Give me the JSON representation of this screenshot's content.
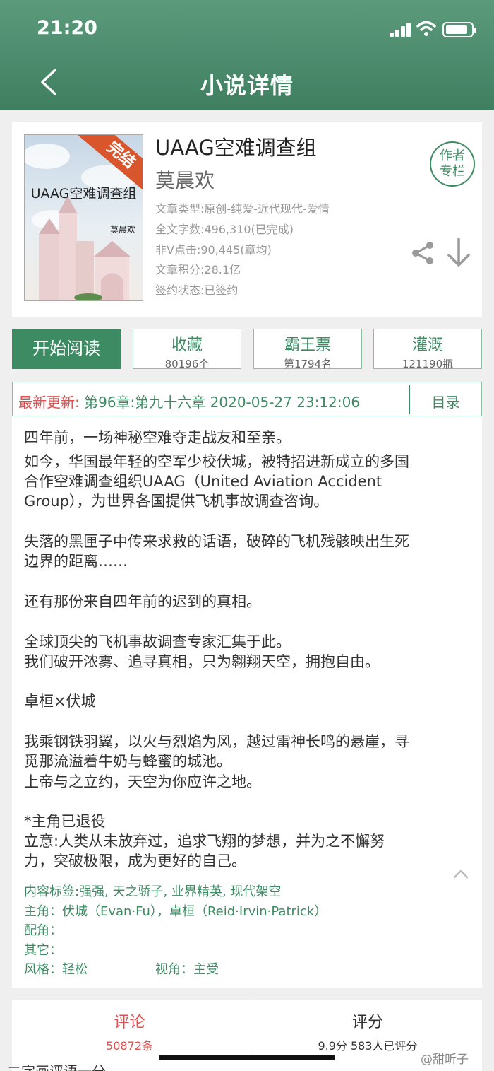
{
  "status_bar": {
    "time": "21:20"
  },
  "header": {
    "title": "小说详情"
  },
  "book": {
    "cover_title": "UAAG空难调查组",
    "cover_author": "莫晨欢",
    "cover_badge": "完结",
    "title": "UAAG空难调查组",
    "author": "莫晨欢",
    "meta": [
      "文章类型:原创-纯爱-近代现代-爱情",
      "全文字数:496,310(已完成)",
      "非Ⅴ点击:90,445(章均)",
      "文章积分:28.1亿",
      "签约状态:已签约"
    ],
    "author_column_line1": "作者",
    "author_column_line2": "专栏"
  },
  "actions": {
    "read_label": "开始阅读",
    "collect_label": "收藏",
    "collect_count": "80196个",
    "bawang_label": "霸王票",
    "bawang_rank": "第1794名",
    "irrigate_label": "灌溉",
    "irrigate_count": "121190瓶"
  },
  "latest_update": {
    "label": "最新更新:",
    "chapter": "第96章:第九十六章 2020-05-27 23:12:06",
    "toc_label": "目录"
  },
  "intro": {
    "lines": [
      "四年前，一场神秘空难夺走战友和至亲。",
      "如今，华国最年轻的空军少校伏城，被特招进新成立的多国",
      "合作空难调查组织UAAG（United Aviation Accident",
      "Group），为世界各国提供飞机事故调查咨询。",
      "失落的黑匣子中传来求救的话语，破碎的飞机残骸映出生死",
      "边界的距离……",
      "还有那份来自四年前的迟到的真相。",
      "全球顶尖的飞机事故调查专家汇集于此。",
      "我们破开浓雾、追寻真相，只为翱翔天空，拥抱自由。",
      "卓桓×伏城",
      "我乘钢铁羽翼，以火与烈焰为风，越过雷神长鸣的悬崖，寻",
      "觅那流溢着牛奶与蜂蜜的城池。",
      "上帝与之立约，天空为你应许之地。",
      "*主角已退役",
      "立意:人类从未放弃过，追求飞翔的梦想，并为之不懈努",
      "力，突破极限，成为更好的自己。"
    ],
    "tags": "内容标签:强强, 天之骄子, 业界精英, 现代架空",
    "protagonists": "主角：伏城（Evan·Fu），卓桓（Reid·Irvin·Patrick）",
    "supporting": "配角：",
    "others": "其它：",
    "style": "风格：轻松",
    "perspective": "视角：主受"
  },
  "stats": {
    "comments_label": "评论",
    "comments_count": "50872条",
    "rating_label": "评分",
    "rating_value": "9.9分 583人已评分"
  },
  "watermark": "@甜昕子",
  "below_text": "二字画评语一分",
  "colors": {
    "header": "#4a8a6b",
    "accent": "#3d8b63",
    "red": "#e05050"
  }
}
